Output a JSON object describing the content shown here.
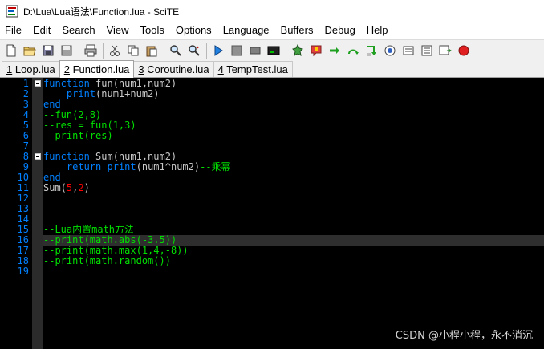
{
  "window": {
    "title": "D:\\Lua\\Lua语法\\Function.lua - SciTE"
  },
  "menu": [
    "File",
    "Edit",
    "Search",
    "View",
    "Tools",
    "Options",
    "Language",
    "Buffers",
    "Debug",
    "Help"
  ],
  "toolbar": {
    "buttons": [
      "new-file",
      "open-file",
      "save-file",
      "save-all",
      "print",
      "cut",
      "copy",
      "paste",
      "find",
      "replace",
      "compile",
      "build",
      "go",
      "stop",
      "output",
      "debug-run",
      "debug-break",
      "step-over",
      "step-into",
      "step-out",
      "watch",
      "locals",
      "stack",
      "breakpoint"
    ]
  },
  "tabs": [
    {
      "num": "1",
      "label": " Loop.lua",
      "active": false
    },
    {
      "num": "2",
      "label": " Function.lua",
      "active": true
    },
    {
      "num": "3",
      "label": " Coroutine.lua",
      "active": false
    },
    {
      "num": "4",
      "label": " TempTest.lua",
      "active": false
    }
  ],
  "editor": {
    "current_line": 16,
    "lines": [
      [
        {
          "t": "function",
          "c": "kw"
        },
        {
          "t": " fun(num1,num2)",
          "c": "id"
        }
      ],
      [
        {
          "t": "    ",
          "c": "id"
        },
        {
          "t": "print",
          "c": "kw"
        },
        {
          "t": "(num1+num2)",
          "c": "id"
        }
      ],
      [
        {
          "t": "end",
          "c": "kw"
        }
      ],
      [
        {
          "t": "--fun(2,8)",
          "c": "cm"
        }
      ],
      [
        {
          "t": "--res = fun(1,3)",
          "c": "cm"
        }
      ],
      [
        {
          "t": "--print(res)",
          "c": "cm"
        }
      ],
      [],
      [
        {
          "t": "function",
          "c": "kw"
        },
        {
          "t": " Sum(num1,num2)",
          "c": "id"
        }
      ],
      [
        {
          "t": "    ",
          "c": "id"
        },
        {
          "t": "return",
          "c": "kw"
        },
        {
          "t": " ",
          "c": "id"
        },
        {
          "t": "print",
          "c": "kw"
        },
        {
          "t": "(num1^num2)",
          "c": "id"
        },
        {
          "t": "--乘幂",
          "c": "cm"
        }
      ],
      [
        {
          "t": "end",
          "c": "kw"
        }
      ],
      [
        {
          "t": "Sum(",
          "c": "id"
        },
        {
          "t": "5",
          "c": "num"
        },
        {
          "t": ",",
          "c": "id"
        },
        {
          "t": "2",
          "c": "num"
        },
        {
          "t": ")",
          "c": "id"
        }
      ],
      [],
      [],
      [],
      [
        {
          "t": "--Lua内置math方法",
          "c": "cm"
        }
      ],
      [
        {
          "t": "--print(math.abs(-3.5))",
          "c": "cm"
        }
      ],
      [
        {
          "t": "--print(math.max(1,4,-8))",
          "c": "cm"
        }
      ],
      [
        {
          "t": "--print(math.random())",
          "c": "cm"
        }
      ],
      []
    ],
    "fold_lines": [
      1,
      8
    ]
  },
  "colors": {
    "kw": "#0080ff",
    "id": "#c8c8c8",
    "cm": "#00e000",
    "num": "#ff0000",
    "line_number": "#0080ff",
    "background": "#000000"
  },
  "watermark": "CSDN @小程小程，永不消沉"
}
